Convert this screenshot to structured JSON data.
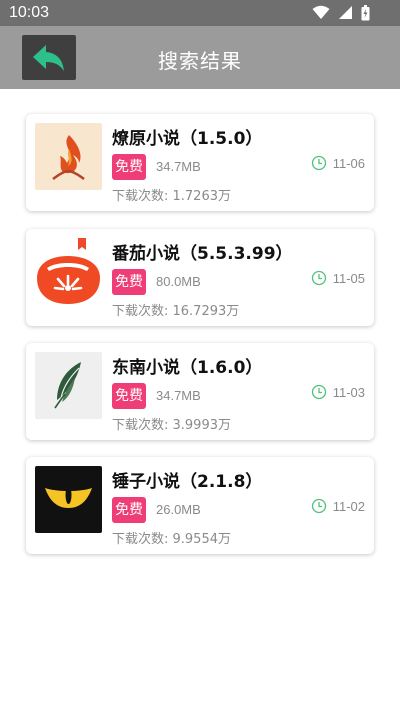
{
  "status_bar": {
    "time": "10:03"
  },
  "header": {
    "title": "搜索结果"
  },
  "apps": [
    {
      "name": "燎原小说（1.5.0）",
      "badge": "免费",
      "size": "34.7MB",
      "date": "11-06",
      "downloads": "下载次数: 1.7263万",
      "icon": "flame-logo-icon"
    },
    {
      "name": "番茄小说（5.5.3.99）",
      "badge": "免费",
      "size": "80.0MB",
      "date": "11-05",
      "downloads": "下载次数: 16.7293万",
      "icon": "tomato-logo-icon"
    },
    {
      "name": "东南小说（1.6.0）",
      "badge": "免费",
      "size": "34.7MB",
      "date": "11-03",
      "downloads": "下载次数: 3.9993万",
      "icon": "feather-logo-icon"
    },
    {
      "name": "锤子小说（2.1.8）",
      "badge": "免费",
      "size": "26.0MB",
      "date": "11-02",
      "downloads": "下载次数: 9.9554万",
      "icon": "eye-logo-icon"
    }
  ],
  "colors": {
    "badge": "#ee3d77",
    "clock": "#4fc27a",
    "header": "#9b9b9b",
    "status_bar": "#6f6f6f",
    "back_arrow": "#2ec08a"
  }
}
